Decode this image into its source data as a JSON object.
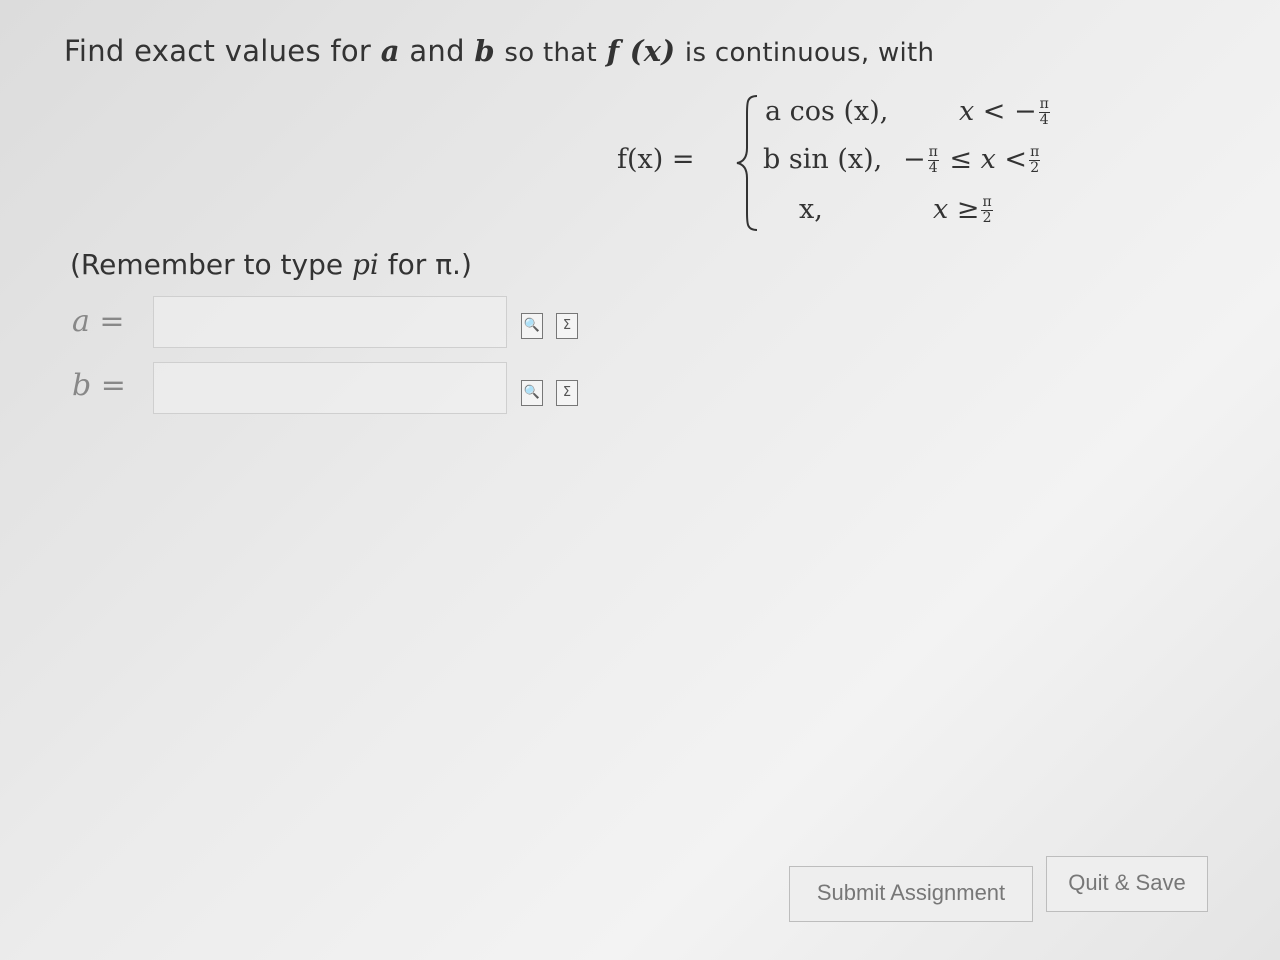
{
  "prompt": {
    "find": "Find exact values for",
    "var_a": "a",
    "and": "and",
    "var_b": "b",
    "so_that": "so that",
    "f_of_x": "f (x)",
    "is_continuous": "is continuous, with"
  },
  "piecewise": {
    "lhs": "f(x) =",
    "cases": [
      {
        "expr": "a cos (x),",
        "cond_left": "x <",
        "cond_frac_num": "π",
        "cond_frac_den": "4",
        "cond_sign": "−"
      },
      {
        "expr": "b sin (x),",
        "cond_pre": "−",
        "cond_frac1_num": "π",
        "cond_frac1_den": "4",
        "cond_mid": "≤ x <",
        "cond_frac2_num": "π",
        "cond_frac2_den": "2"
      },
      {
        "expr": "x,",
        "cond_left": "x ≥",
        "cond_frac_num": "π",
        "cond_frac_den": "2"
      }
    ]
  },
  "remember": {
    "pre": "(Remember to type ",
    "pi_word": "pi",
    "post": " for π.)"
  },
  "answers": [
    {
      "label": "a =",
      "value": "",
      "placeholder": ""
    },
    {
      "label": "b =",
      "value": "",
      "placeholder": ""
    }
  ],
  "icons": [
    "preview-icon",
    "equation-editor-icon"
  ],
  "buttons": {
    "submit": "Submit Assignment",
    "quit": "Quit & Save"
  }
}
